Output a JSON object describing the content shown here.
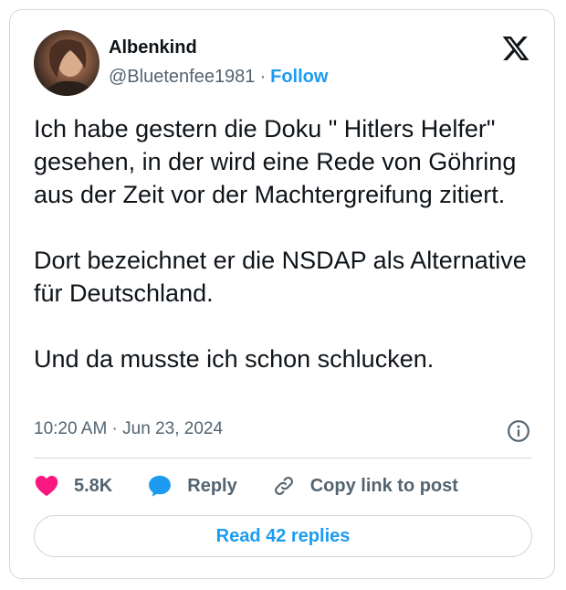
{
  "author": {
    "display_name": "Albenkind",
    "handle": "@Bluetenfee1981",
    "separator": "·",
    "follow_label": "Follow"
  },
  "tweet": {
    "paragraphs": [
      "Ich habe gestern die Doku \" Hitlers Helfer\" gesehen, in der wird eine Rede von Göhring aus der Zeit vor der Machtergreifung zitiert.",
      "Dort bezeichnet er die NSDAP als Alternative für Deutschland.",
      "Und da musste ich schon schlucken."
    ],
    "timestamp": "10:20 AM · Jun 23, 2024"
  },
  "actions": {
    "like_count": "5.8K",
    "reply_label": "Reply",
    "copy_link_label": "Copy link to post"
  },
  "read_replies_label": "Read 42 replies",
  "icons": {
    "platform_logo": "x-logo-icon",
    "info": "info-icon",
    "like": "heart-icon",
    "reply": "speech-bubble-icon",
    "copy": "link-icon"
  },
  "colors": {
    "accent": "#1d9bf0",
    "like": "#f91880",
    "secondary_text": "#536471",
    "border": "#cfd9de"
  }
}
